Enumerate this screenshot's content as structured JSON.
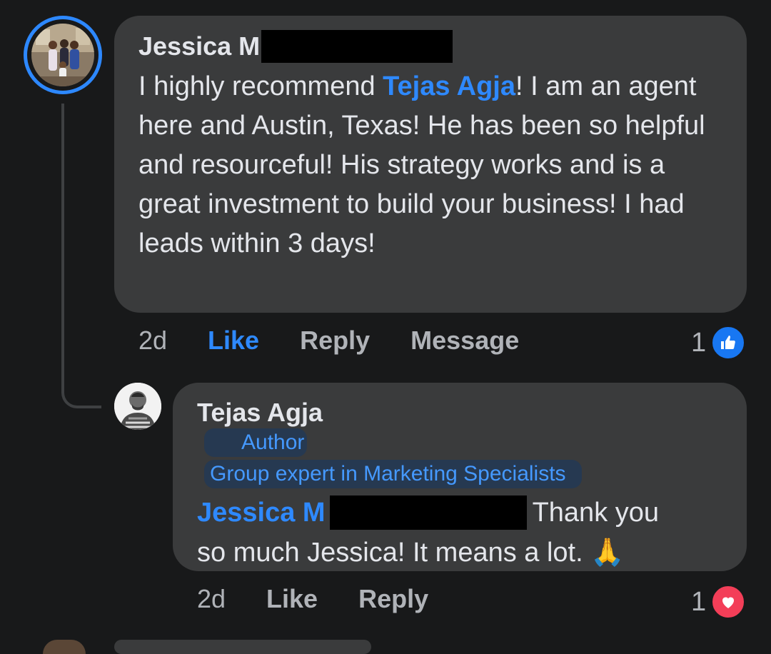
{
  "comment": {
    "author": "Jessica M",
    "mention": "Tejas Agja",
    "text_before_mention": "I highly recommend ",
    "text_after_mention": "! I am an agent here and Austin, Texas! He has been so helpful and resourceful! His strategy works and is a great investment to build your business! I had leads within 3 days!",
    "time": "2d",
    "like_label": "Like",
    "reply_label": "Reply",
    "message_label": "Message",
    "reaction_count": "1",
    "reaction_icon": "like-icon"
  },
  "reply": {
    "author": "Tejas Agja",
    "badge_author": "Author",
    "badge_expert": "Group expert in Marketing Specialists",
    "mention": "Jessica M",
    "text_line1": "Thank you",
    "text_line2": "so much Jessica! It means a lot. 🙏",
    "time": "2d",
    "like_label": "Like",
    "reply_label": "Reply",
    "reaction_count": "1",
    "reaction_icon": "love-icon"
  },
  "colors": {
    "background": "#18191a",
    "bubble": "#3a3b3c",
    "link_blue": "#2e89ff",
    "badge_bg": "#263951",
    "muted": "#b0b3b8"
  }
}
